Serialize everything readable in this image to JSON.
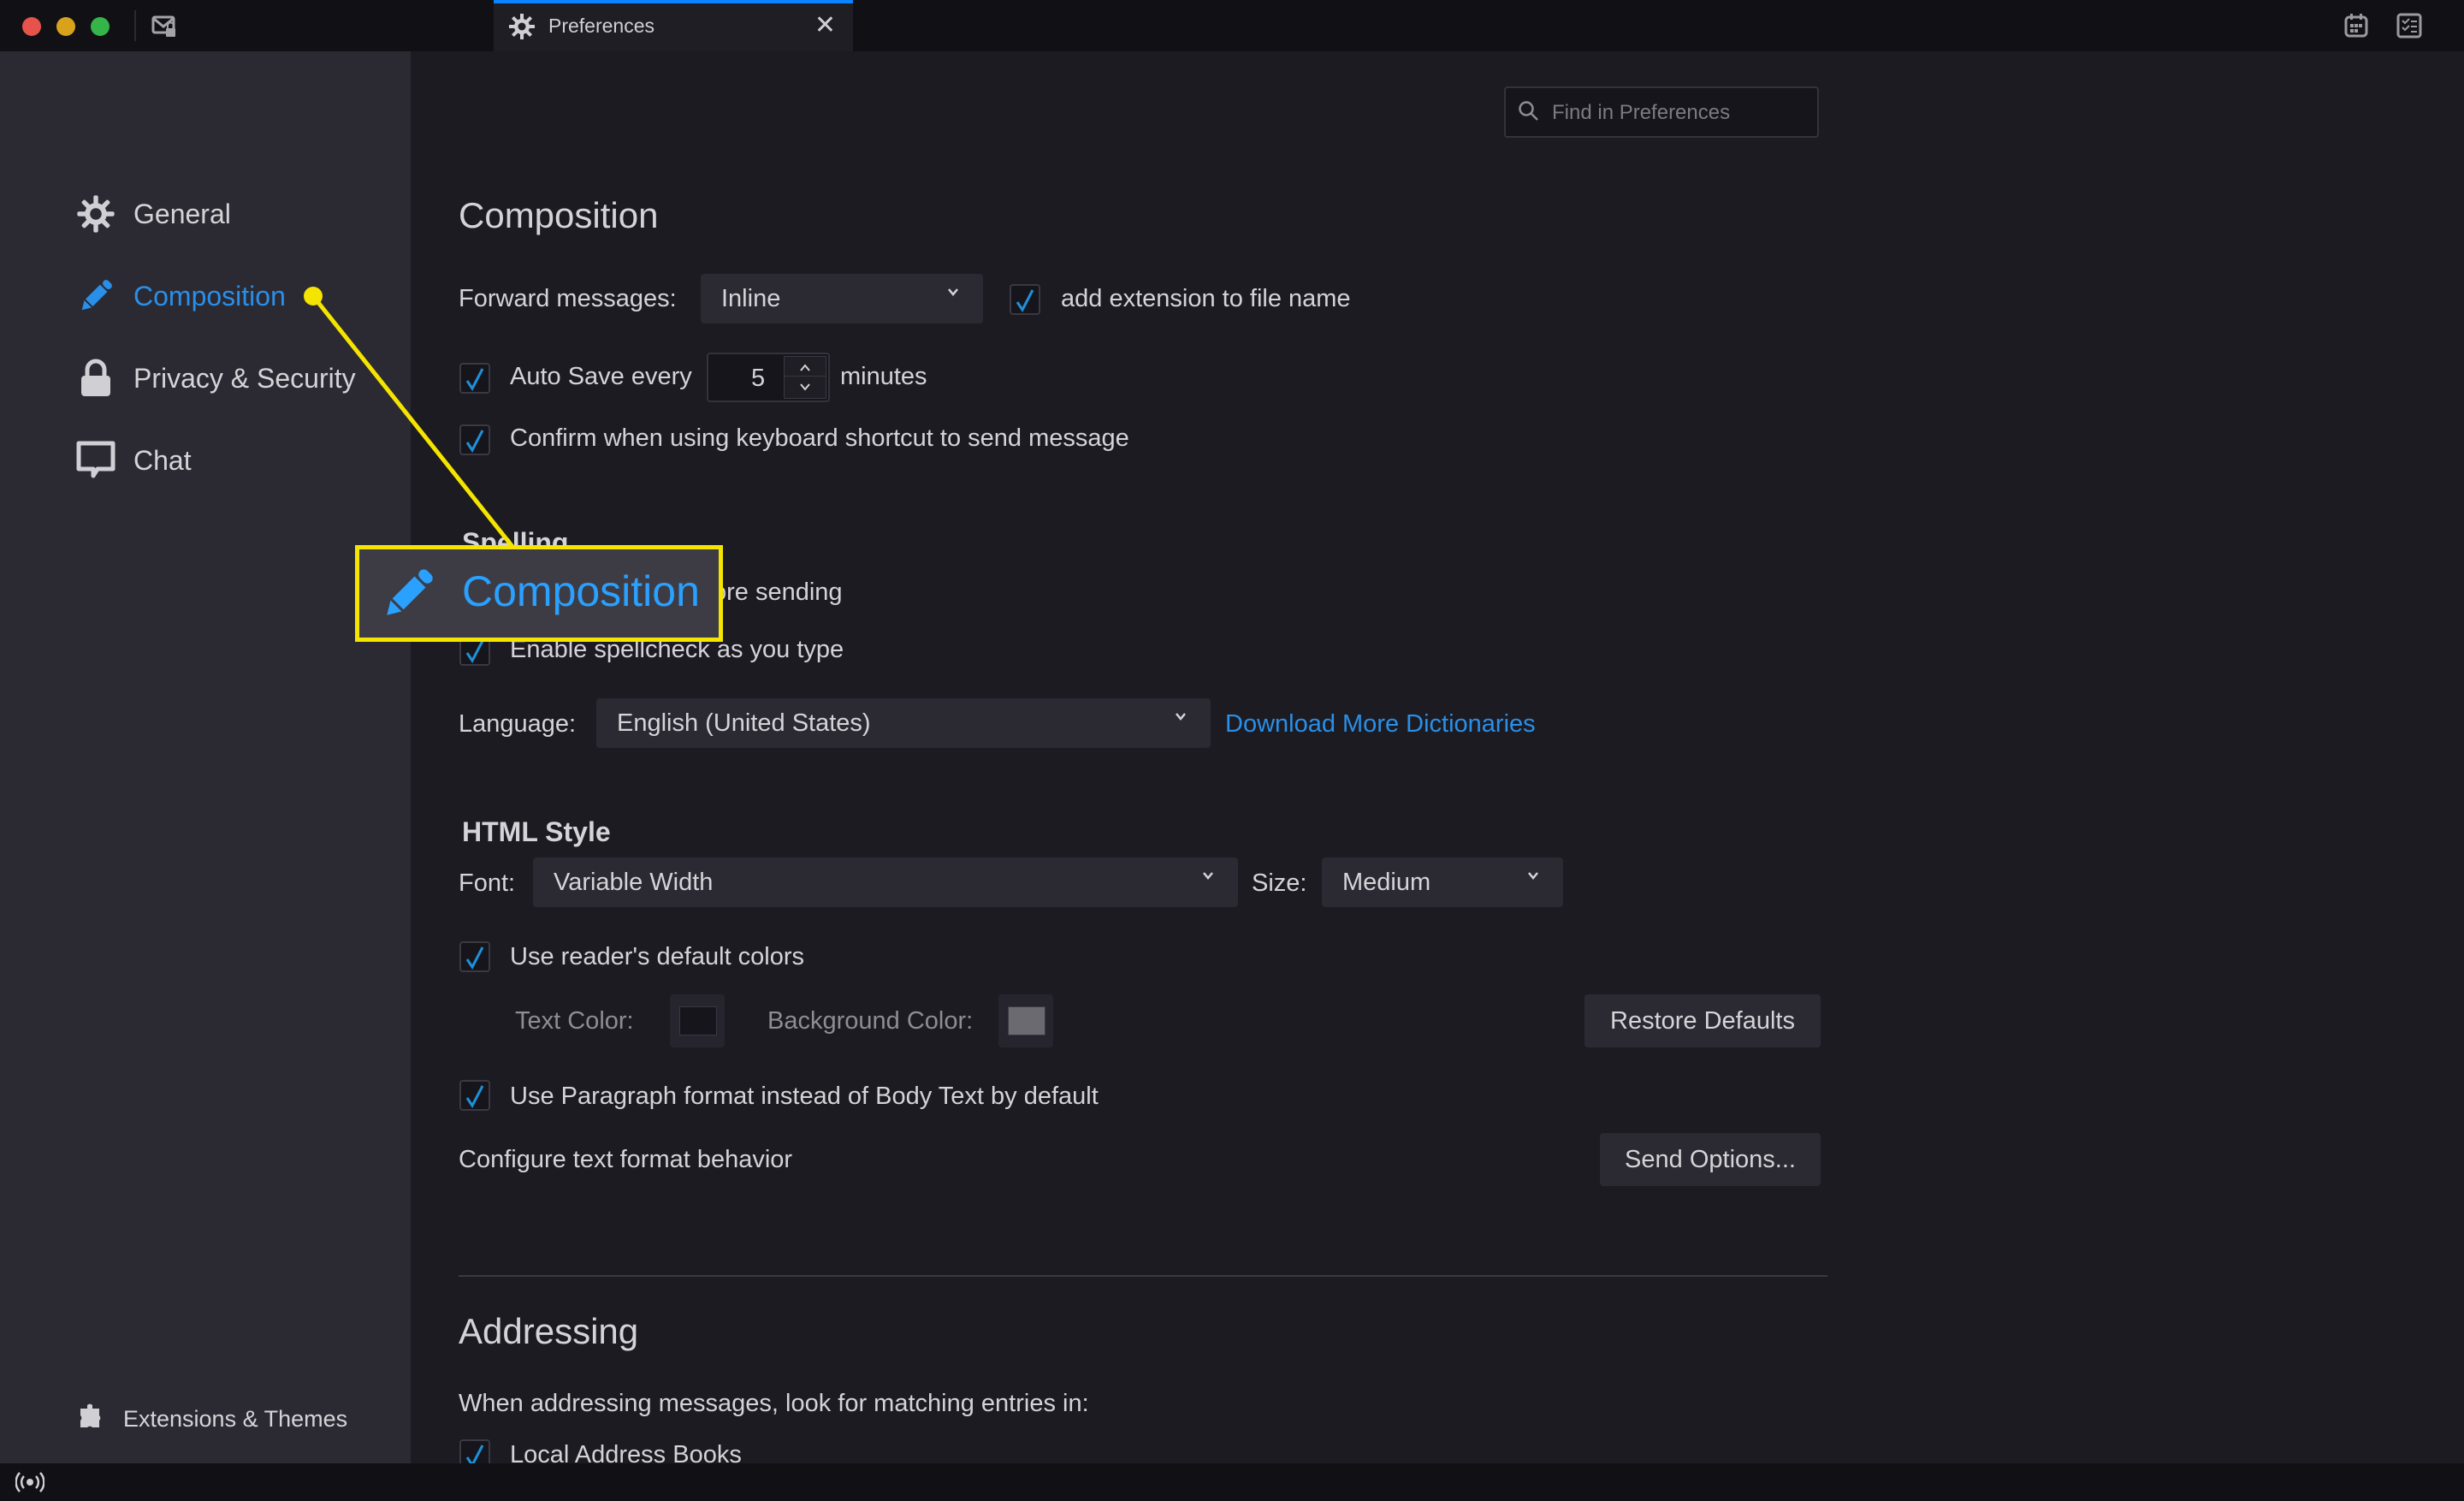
{
  "window": {
    "tab": {
      "label": "Preferences",
      "close_icon": "close-icon",
      "icon": "gear-icon"
    },
    "titlebar_icons": [
      "mail-lock-icon",
      "calendar-icon",
      "tasks-icon"
    ]
  },
  "search": {
    "placeholder": "Find in Preferences",
    "value": ""
  },
  "sidebar": {
    "items": [
      {
        "label": "General",
        "icon": "gear-icon",
        "active": false
      },
      {
        "label": "Composition",
        "icon": "pencil-icon",
        "active": true
      },
      {
        "label": "Privacy & Security",
        "icon": "lock-icon",
        "active": false
      },
      {
        "label": "Chat",
        "icon": "chat-bubble-icon",
        "active": false
      }
    ],
    "footer": {
      "label": "Extensions & Themes",
      "icon": "puzzle-icon"
    }
  },
  "composition": {
    "title": "Composition",
    "forward_label": "Forward messages:",
    "forward_value": "Inline",
    "add_extension": {
      "label": "add extension to file name",
      "checked": true
    },
    "autosave": {
      "label": "Auto Save every",
      "value": "5",
      "unit": "minutes",
      "checked": true
    },
    "confirm_shortcut": {
      "label": "Confirm when using keyboard shortcut to send message",
      "checked": true
    }
  },
  "spelling": {
    "title": "Spelling",
    "check_before_send": {
      "label": "Check spelling before sending",
      "visible_part": "fore sending"
    },
    "spellcheck_as_type": {
      "label": "Enable spellcheck as you type",
      "checked": true
    },
    "language_label": "Language:",
    "language_value": "English (United States)",
    "download_link": "Download More Dictionaries"
  },
  "html_style": {
    "title": "HTML Style",
    "font_label": "Font:",
    "font_value": "Variable Width",
    "size_label": "Size:",
    "size_value": "Medium",
    "reader_colors": {
      "label": "Use reader's default colors",
      "checked": true
    },
    "text_color_label": "Text Color:",
    "text_color": "#16151b",
    "bg_color_label": "Background Color:",
    "bg_color": "#6b6a70",
    "restore_defaults": "Restore Defaults",
    "paragraph_format": {
      "label": "Use Paragraph format instead of Body Text by default",
      "checked": true
    },
    "configure_label": "Configure text format behavior",
    "send_options": "Send Options..."
  },
  "addressing": {
    "title": "Addressing",
    "description": "When addressing messages, look for matching entries in:",
    "local_books": {
      "label": "Local Address Books",
      "checked": true
    }
  },
  "callout": {
    "label": "Composition",
    "icon": "pencil-icon",
    "color": "#f5e400"
  },
  "colors": {
    "accent": "#2a8fe8",
    "checkmark": "#1e90d8",
    "highlight": "#f5e400"
  },
  "statusbar": {
    "icon": "online-status-icon"
  }
}
